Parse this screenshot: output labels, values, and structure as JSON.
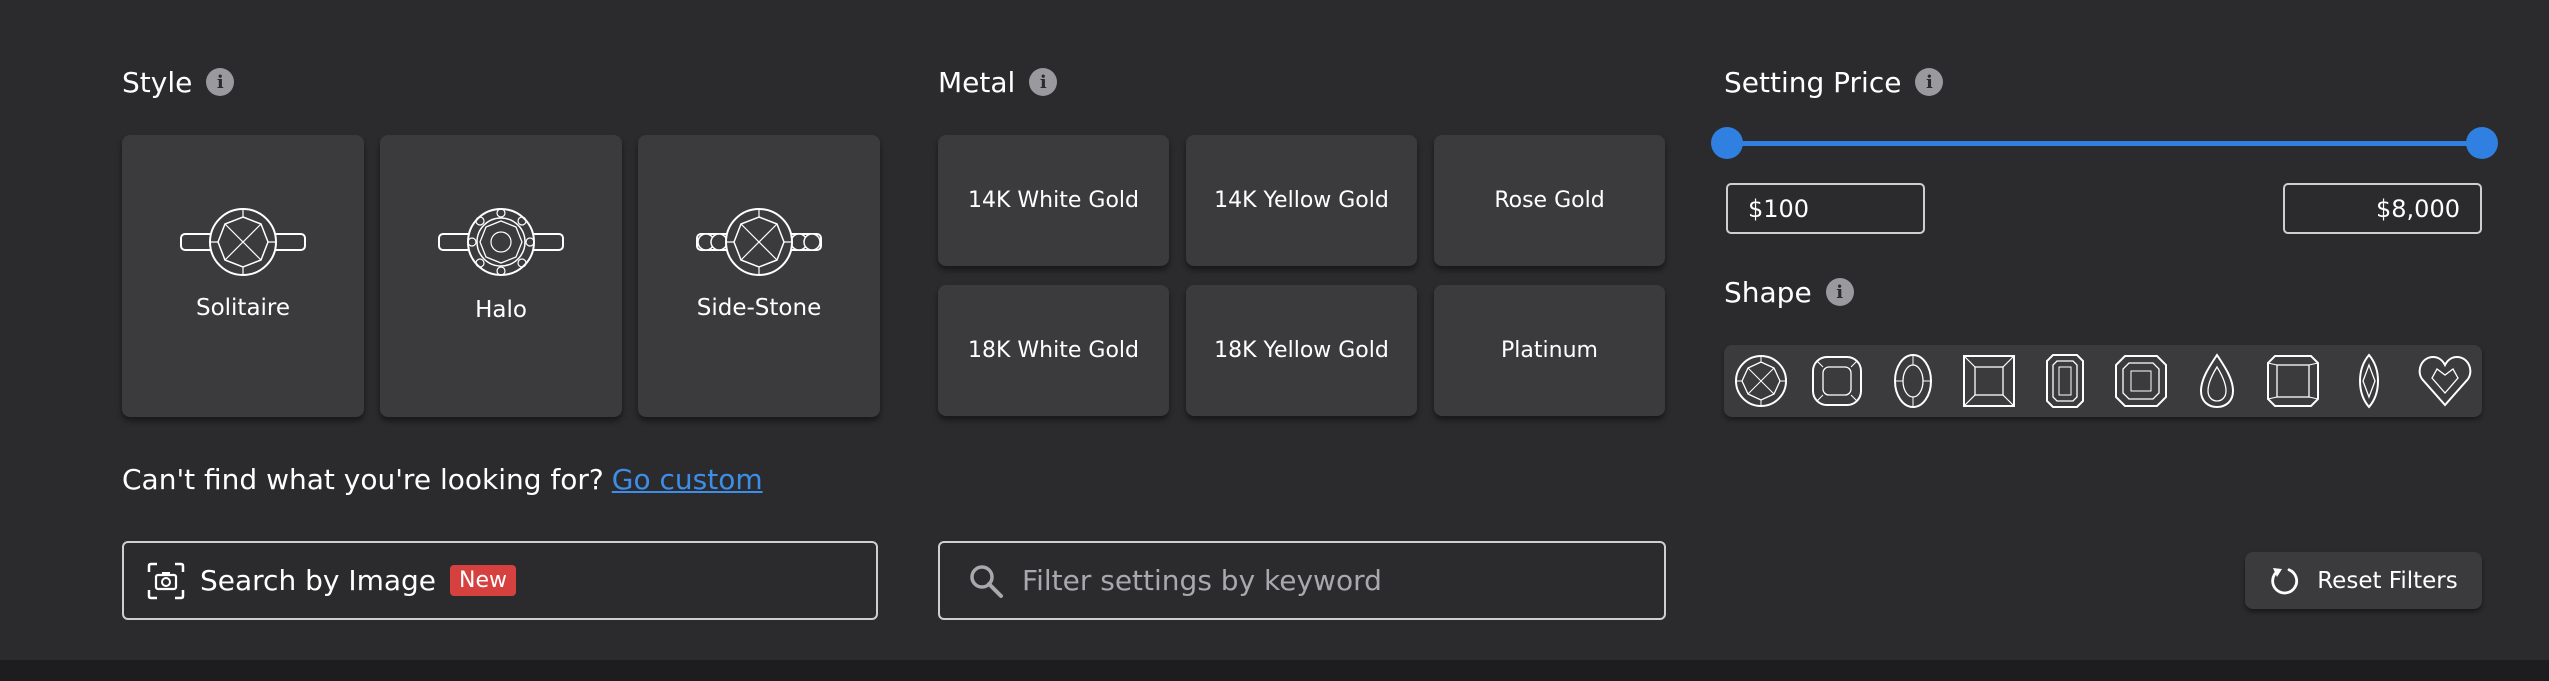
{
  "style": {
    "title": "Style",
    "options": [
      {
        "label": "Solitaire",
        "icon": "solitaire-ring-icon"
      },
      {
        "label": "Halo",
        "icon": "halo-ring-icon"
      },
      {
        "label": "Side-Stone",
        "icon": "side-stone-ring-icon"
      }
    ]
  },
  "metal": {
    "title": "Metal",
    "options": [
      {
        "label": "14K White Gold"
      },
      {
        "label": "14K Yellow Gold"
      },
      {
        "label": "Rose Gold"
      },
      {
        "label": "18K White Gold"
      },
      {
        "label": "18K Yellow Gold"
      },
      {
        "label": "Platinum"
      }
    ]
  },
  "price": {
    "title": "Setting Price",
    "min": "$100",
    "max": "$8,000",
    "range_fraction": [
      0,
      1
    ]
  },
  "shape": {
    "title": "Shape",
    "options": [
      "round-shape-icon",
      "cushion-shape-icon",
      "oval-shape-icon",
      "princess-shape-icon",
      "emerald-shape-icon",
      "asscher-shape-icon",
      "pear-shape-icon",
      "radiant-shape-icon",
      "marquise-shape-icon",
      "heart-shape-icon"
    ]
  },
  "custom": {
    "prompt": "Can't find what you're looking for?",
    "link": "Go custom"
  },
  "search_image": {
    "label": "Search by Image",
    "badge": "New"
  },
  "keyword": {
    "placeholder": "Filter settings by keyword"
  },
  "reset": {
    "label": "Reset Filters"
  },
  "colors": {
    "background": "#2b2b2d",
    "card": "#3b3b3d",
    "accent": "#2f80e0",
    "link": "#3d8ee8",
    "badge": "#d6413f"
  }
}
